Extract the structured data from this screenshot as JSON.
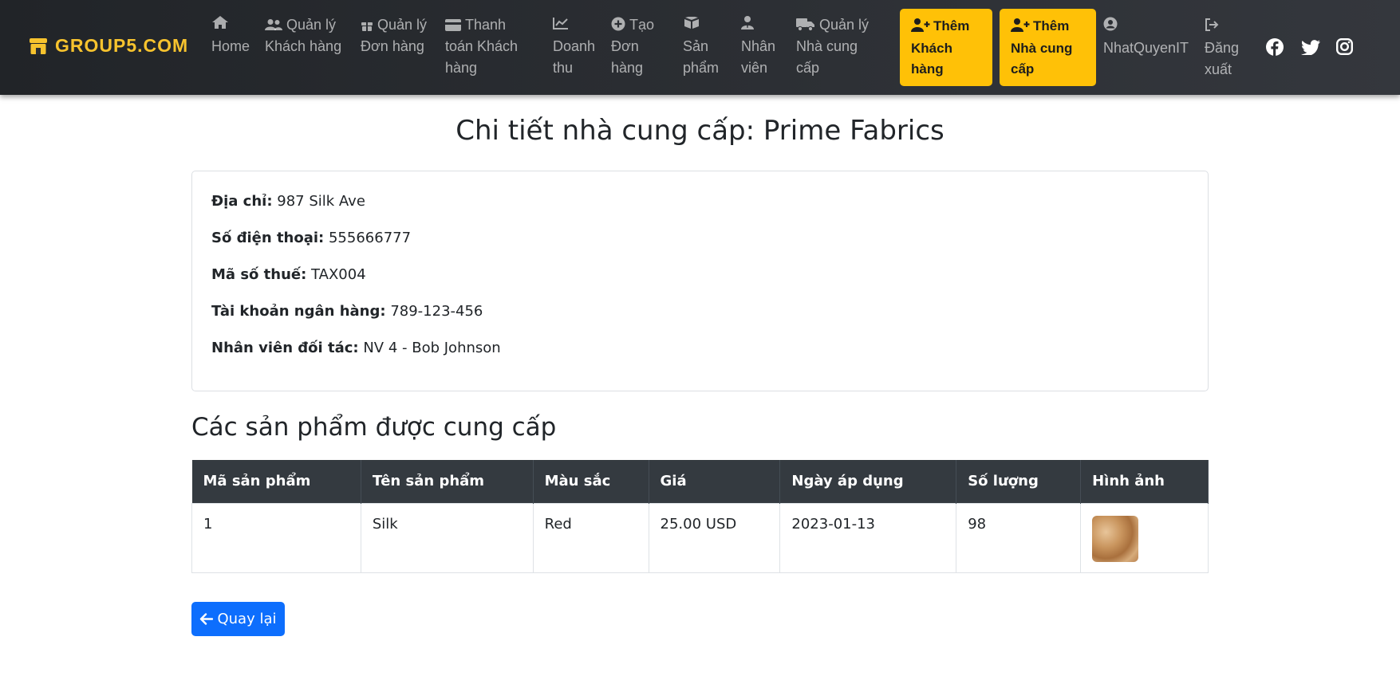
{
  "brand": {
    "name": "GROUP5.COM",
    "icon": "store-icon"
  },
  "nav": {
    "home": [
      "Home"
    ],
    "customers": [
      "Quản lý",
      "Khách hàng"
    ],
    "orders": [
      "Quản lý",
      "Đơn hàng"
    ],
    "payments": [
      "Thanh",
      "toán Khách",
      "hàng"
    ],
    "revenue": [
      "Doanh",
      "thu"
    ],
    "create_order": [
      "Tạo",
      "Đơn",
      "hàng"
    ],
    "products": [
      "Sản",
      "phẩm"
    ],
    "employees": [
      "Nhân",
      "viên"
    ],
    "suppliers": [
      "Quản lý",
      "Nhà cung",
      "cấp"
    ],
    "add_customer": [
      "Thêm",
      "Khách",
      "hàng"
    ],
    "add_supplier": [
      "Thêm",
      "Nhà cung",
      "cấp"
    ],
    "user": [
      "NhatQuyenIT"
    ],
    "logout": [
      "Đăng",
      "xuất"
    ]
  },
  "page": {
    "title": "Chi tiết nhà cung cấp: Prime Fabrics",
    "section_title": "Các sản phẩm được cung cấp",
    "back_label": "Quay lại"
  },
  "supplier": {
    "address_label": "Địa chỉ:",
    "address": "987 Silk Ave",
    "phone_label": "Số điện thoại:",
    "phone": "555666777",
    "tax_label": "Mã số thuế:",
    "tax": "TAX004",
    "bank_label": "Tài khoản ngân hàng:",
    "bank": "789-123-456",
    "partner_label": "Nhân viên đối tác:",
    "partner": "NV 4 - Bob Johnson"
  },
  "table": {
    "headers": [
      "Mã sản phẩm",
      "Tên sản phẩm",
      "Màu sắc",
      "Giá",
      "Ngày áp dụng",
      "Số lượng",
      "Hình ảnh"
    ],
    "rows": [
      {
        "id": "1",
        "name": "Silk",
        "color": "Red",
        "price": "25.00 USD",
        "date": "2023-01-13",
        "quantity": "98"
      }
    ]
  },
  "colors": {
    "navbar": "#2b2e33",
    "accent": "#ffc107",
    "brand": "#f7c32e",
    "primary": "#0d6efd"
  }
}
